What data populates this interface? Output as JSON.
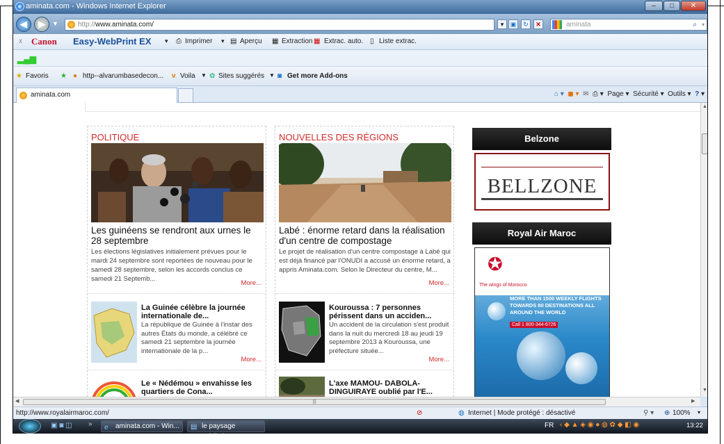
{
  "window": {
    "title": "aminata.com - Windows Internet Explorer"
  },
  "address": {
    "prefix": "http://",
    "host": "www.aminata.com/",
    "search_value": "aminata"
  },
  "canon_bar": {
    "close": "x",
    "brand": "Canon",
    "product": "Easy-WebPrint EX",
    "print": "Imprimer",
    "preview": "Aperçu",
    "extraction": "Extraction",
    "auto_extraction": "Extrac. auto.",
    "list": "Liste extrac."
  },
  "favorites_bar": {
    "favorites": "Favoris",
    "link1": "http--alvarumbasedecon...",
    "link2": "Voila",
    "link3": "Sites suggérés",
    "link4": "Get more Add-ons"
  },
  "tab": {
    "label": "aminata.com"
  },
  "command_bar": {
    "page": "Page",
    "security": "Sécurité",
    "tools": "Outils"
  },
  "columns": [
    {
      "category": "POLITIQUE",
      "headline": "Les guinéens se rendront aux urnes le 28 septembre",
      "summary": "Les élections législatives initialement prévues pour le mardi 24 septembre sont reportées de nouveau pour le samedi 28 septembre, selon les accords conclus ce samedi 21 Septemb...",
      "more": "More...",
      "items": [
        {
          "title": "La Guinée célèbre la journée internationale de...",
          "summary": "La république de Guinée à l'instar des autres États du monde, a célébré ce samedi 21 septembre la journée internationale de la p...",
          "more": "More..."
        },
        {
          "title": "Le « Nédémou » envahisse les quartiers de Cona...",
          "summary": "",
          "more": ""
        }
      ]
    },
    {
      "category": "NOUVELLES DES RÉGIONS",
      "headline": "Labé : énorme retard dans la réalisation d'un centre de compostage",
      "summary": "Le projet de réalisation d'un centre compostage à Labé qui est déjà financé par l'ONUDI a accusé un énorme retard, a appris Aminata.com. Selon le Directeur du centre, M...",
      "more": "More...",
      "items": [
        {
          "title": "Kouroussa : 7 personnes périssent dans un acciden...",
          "summary": "Un accident de la circulation s'est produit dans la nuit du mercredi 18 au jeudi  19 septembre 2013 à Kouroussa, une préfecture située...",
          "more": "More..."
        },
        {
          "title": "L'axe MAMOU- DABOLA-DINGUIRAYE oublié par l'E...",
          "summary": "",
          "more": ""
        }
      ]
    }
  ],
  "sidebar": {
    "ad1_header": "Belzone",
    "ad1_logo": "BELLZONE",
    "ad2_header": "Royal Air Maroc",
    "ad2_tagline": "The wings of Morocco",
    "ad2_text": "MORE THAN 1500 WEEKLY FLIGHTS TOWARDS 80 DESTINATIONS ALL AROUND THE WORLD",
    "ad2_phone": "Call 1 800-344-6726"
  },
  "status_bar": {
    "url": "http://www.royalairmaroc.com/",
    "zone": "Internet | Mode protégé : désactivé",
    "zoom": "100%"
  },
  "taskbar": {
    "task1": "aminata.com - Win...",
    "task2": "le paysage médiatiq...",
    "lang": "FR",
    "time": "13:22"
  }
}
